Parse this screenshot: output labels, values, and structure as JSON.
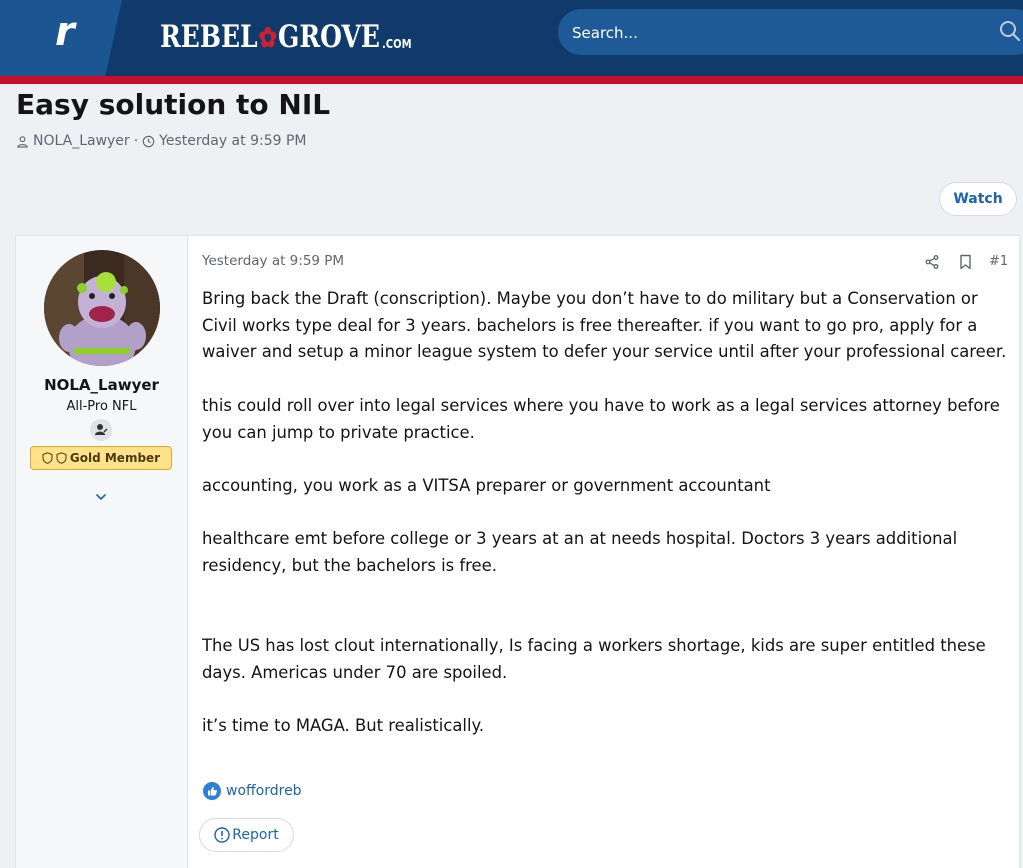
{
  "header": {
    "logo_letter": "r",
    "brand_left": "REBEL",
    "brand_right": "GROVE",
    "brand_suffix": ".COM",
    "search_placeholder": "Search...",
    "colors": {
      "bar": "#0f3a6b",
      "accent": "#c8102e",
      "search": "#1d5a97"
    }
  },
  "thread": {
    "title": "Easy solution to NIL",
    "author": "NOLA_Lawyer",
    "separator": "·",
    "time": "Yesterday at 9:59 PM",
    "watch_label": "Watch"
  },
  "post": {
    "user": {
      "name": "NOLA_Lawyer",
      "title": "All-Pro NFL",
      "banner": "Gold Member"
    },
    "date": "Yesterday at 9:59 PM",
    "number": "#1",
    "paragraphs": [
      "Bring back the Draft (conscription). Maybe you don’t have to do military but a Conservation or Civil works type deal for 3 years. bachelors is free thereafter. if you want to go pro, apply for a waiver and setup a minor league system to defer your service until after your professional career.",
      "this could roll over into legal services where you have to work as a legal services attorney before you can jump to private practice.",
      "accounting, you work as a VITSA preparer or government accountant",
      "healthcare emt before college or 3 years at an at needs hospital. Doctors 3 years additional residency, but the bachelors is free.",
      "The US has lost clout internationally, Is facing a workers shortage, kids are super entitled these days. Americas under 70 are spoiled.",
      "it’s time to MAGA. But realistically."
    ],
    "reaction_user": "woffordreb",
    "report_label": "Report"
  }
}
